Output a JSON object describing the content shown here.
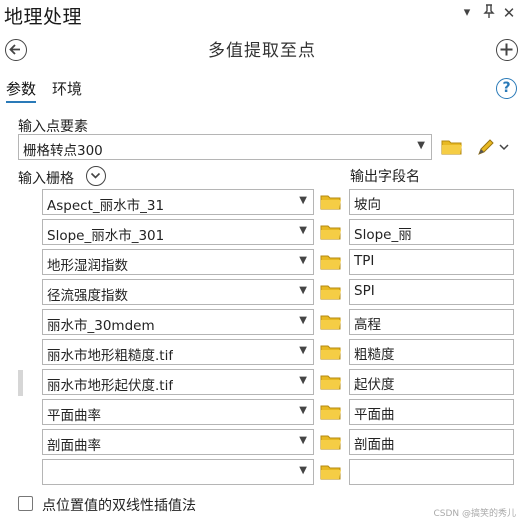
{
  "pane": {
    "title": "地理处理"
  },
  "tool": {
    "name": "多值提取至点"
  },
  "tabs": [
    {
      "label": "参数"
    },
    {
      "label": "环境"
    }
  ],
  "input_points": {
    "label": "输入点要素",
    "value": "栅格转点300"
  },
  "rasters": {
    "label": "输入栅格",
    "output_label": "输出字段名",
    "rows": [
      {
        "raster": "Aspect_丽水市_31",
        "field": "坡向"
      },
      {
        "raster": "Slope_丽水市_301",
        "field": "Slope_丽"
      },
      {
        "raster": "地形湿润指数",
        "field": "TPI"
      },
      {
        "raster": "径流强度指数",
        "field": "SPI"
      },
      {
        "raster": "丽水市_30mdem",
        "field": "高程"
      },
      {
        "raster": "丽水市地形粗糙度.tif",
        "field": "粗糙度"
      },
      {
        "raster": "丽水市地形起伏度.tif",
        "field": "起伏度"
      },
      {
        "raster": "平面曲率",
        "field": "平面曲"
      },
      {
        "raster": "剖面曲率",
        "field": "剖面曲"
      },
      {
        "raster": "",
        "field": ""
      }
    ]
  },
  "bilinear": {
    "label": "点位置值的双线性插值法",
    "checked": false
  },
  "watermark": "CSDN @搞笑的秀儿",
  "colors": {
    "accent": "#2a7ab8",
    "folder": "#e8b923"
  }
}
